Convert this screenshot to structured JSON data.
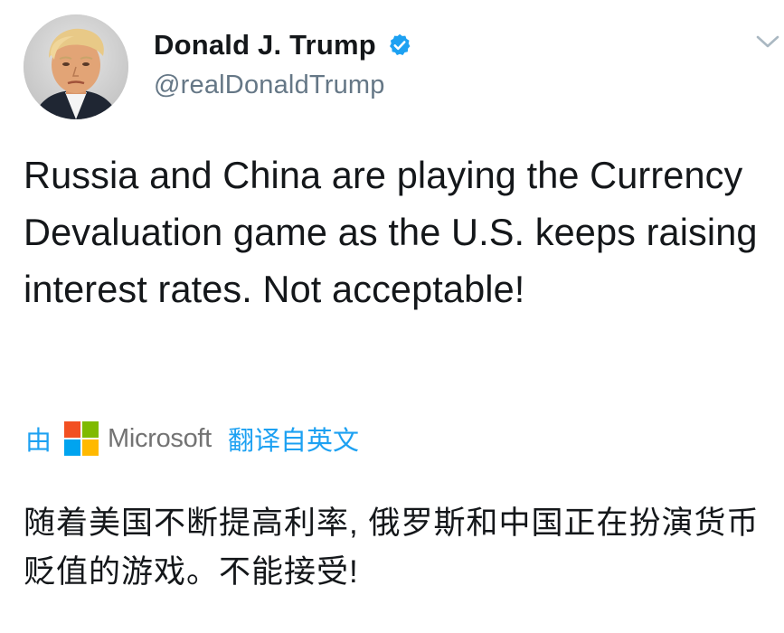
{
  "author": {
    "display_name": "Donald J. Trump",
    "handle": "@realDonaldTrump",
    "verified": true,
    "verified_color": "#1da1f2"
  },
  "tweet": {
    "text": "Russia and China are playing the Currency Devaluation game as the U.S. keeps raising interest rates. Not acceptable!"
  },
  "translation": {
    "by_label": "由",
    "provider": "Microsoft",
    "action_label": "翻译自英文",
    "text": "随着美国不断提高利率, 俄罗斯和中国正在扮演货币贬值的游戏。不能接受!",
    "accent_color": "#1da1f2",
    "logo_colors": [
      "#f25022",
      "#7fba00",
      "#00a4ef",
      "#ffb900"
    ]
  },
  "icons": {
    "menu": "chevron-down-icon",
    "verified": "verified-badge-icon",
    "avatar": "profile-photo"
  }
}
